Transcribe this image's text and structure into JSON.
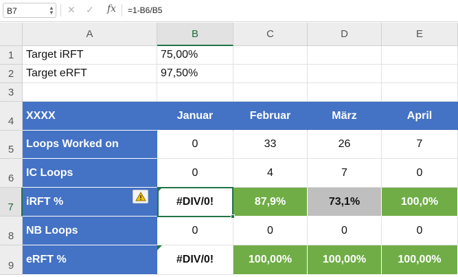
{
  "formula_bar": {
    "name_box": "B7",
    "cancel_glyph": "✕",
    "enter_glyph": "✓",
    "fx_label": "fx",
    "formula": "=1-B6/B5"
  },
  "columns": [
    "A",
    "B",
    "C",
    "D",
    "E"
  ],
  "rows": [
    "1",
    "2",
    "3",
    "4",
    "5",
    "6",
    "7",
    "8",
    "9"
  ],
  "selected_cell": {
    "column": "B",
    "row": "7"
  },
  "targets": [
    {
      "label": "Target iRFT",
      "value": "75,00%"
    },
    {
      "label": "Target eRFT",
      "value": "97,50%"
    }
  ],
  "table": {
    "header": {
      "label": "XXXX",
      "months": [
        "Januar",
        "Februar",
        "März",
        "April"
      ]
    },
    "rows": [
      {
        "label": "Loops Worked on",
        "values": [
          "0",
          "33",
          "26",
          "7"
        ]
      },
      {
        "label": "IC Loops",
        "values": [
          "0",
          "4",
          "7",
          "0"
        ]
      },
      {
        "label": "iRFT %",
        "values": [
          "#DIV/0!",
          "87,9%",
          "73,1%",
          "100,0%"
        ]
      },
      {
        "label": "NB Loops",
        "values": [
          "0",
          "0",
          "0",
          "0"
        ]
      },
      {
        "label": "eRFT %",
        "values": [
          "#DIV/0!",
          "100,00%",
          "100,00%",
          "100,00%"
        ]
      }
    ]
  },
  "colors": {
    "header_blue": "#4472c4",
    "good_green": "#70ad47",
    "below_target_gray": "#bfbfbf",
    "selection_green": "#217346"
  },
  "icons": {
    "error_warning": "warning-icon"
  }
}
